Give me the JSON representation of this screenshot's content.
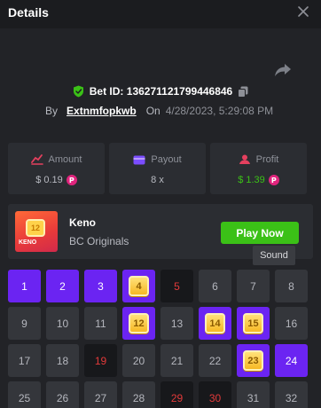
{
  "header": {
    "title": "Details"
  },
  "bet": {
    "id_text": "Bet ID: 136271121799446846",
    "by_label": "By",
    "username": "Extnmfopkwb",
    "on_label": "On",
    "date": "4/28/2023, 5:29:08 PM"
  },
  "stats": {
    "amount": {
      "label": "Amount",
      "value": "$ 0.19",
      "coin": "P"
    },
    "payout": {
      "label": "Payout",
      "value": "8 x"
    },
    "profit": {
      "label": "Profit",
      "value": "$ 1.39",
      "coin": "P"
    }
  },
  "game": {
    "name": "Keno",
    "provider": "BC Originals",
    "thumb_label": "KENO",
    "thumb_number": "12",
    "play_label": "Play Now",
    "tooltip": "Sound"
  },
  "colors": {
    "pick": "#6b24f2",
    "hit": "#f7b824",
    "miss_text": "#e23a3a",
    "profit": "#3bc117",
    "play": "#3bc117",
    "coin": "#e0247d"
  },
  "keno": {
    "cells": [
      {
        "n": "1",
        "state": "pick"
      },
      {
        "n": "2",
        "state": "pick"
      },
      {
        "n": "3",
        "state": "pick"
      },
      {
        "n": "4",
        "state": "hit"
      },
      {
        "n": "5",
        "state": "miss"
      },
      {
        "n": "6",
        "state": "none"
      },
      {
        "n": "7",
        "state": "none"
      },
      {
        "n": "8",
        "state": "none"
      },
      {
        "n": "9",
        "state": "none"
      },
      {
        "n": "10",
        "state": "none"
      },
      {
        "n": "11",
        "state": "none"
      },
      {
        "n": "12",
        "state": "hit"
      },
      {
        "n": "13",
        "state": "none"
      },
      {
        "n": "14",
        "state": "hit"
      },
      {
        "n": "15",
        "state": "hit"
      },
      {
        "n": "16",
        "state": "none"
      },
      {
        "n": "17",
        "state": "none"
      },
      {
        "n": "18",
        "state": "none"
      },
      {
        "n": "19",
        "state": "miss"
      },
      {
        "n": "20",
        "state": "none"
      },
      {
        "n": "21",
        "state": "none"
      },
      {
        "n": "22",
        "state": "none"
      },
      {
        "n": "23",
        "state": "hit"
      },
      {
        "n": "24",
        "state": "pick"
      },
      {
        "n": "25",
        "state": "none"
      },
      {
        "n": "26",
        "state": "none"
      },
      {
        "n": "27",
        "state": "none"
      },
      {
        "n": "28",
        "state": "none"
      },
      {
        "n": "29",
        "state": "miss"
      },
      {
        "n": "30",
        "state": "miss"
      },
      {
        "n": "31",
        "state": "none"
      },
      {
        "n": "32",
        "state": "none"
      }
    ]
  }
}
